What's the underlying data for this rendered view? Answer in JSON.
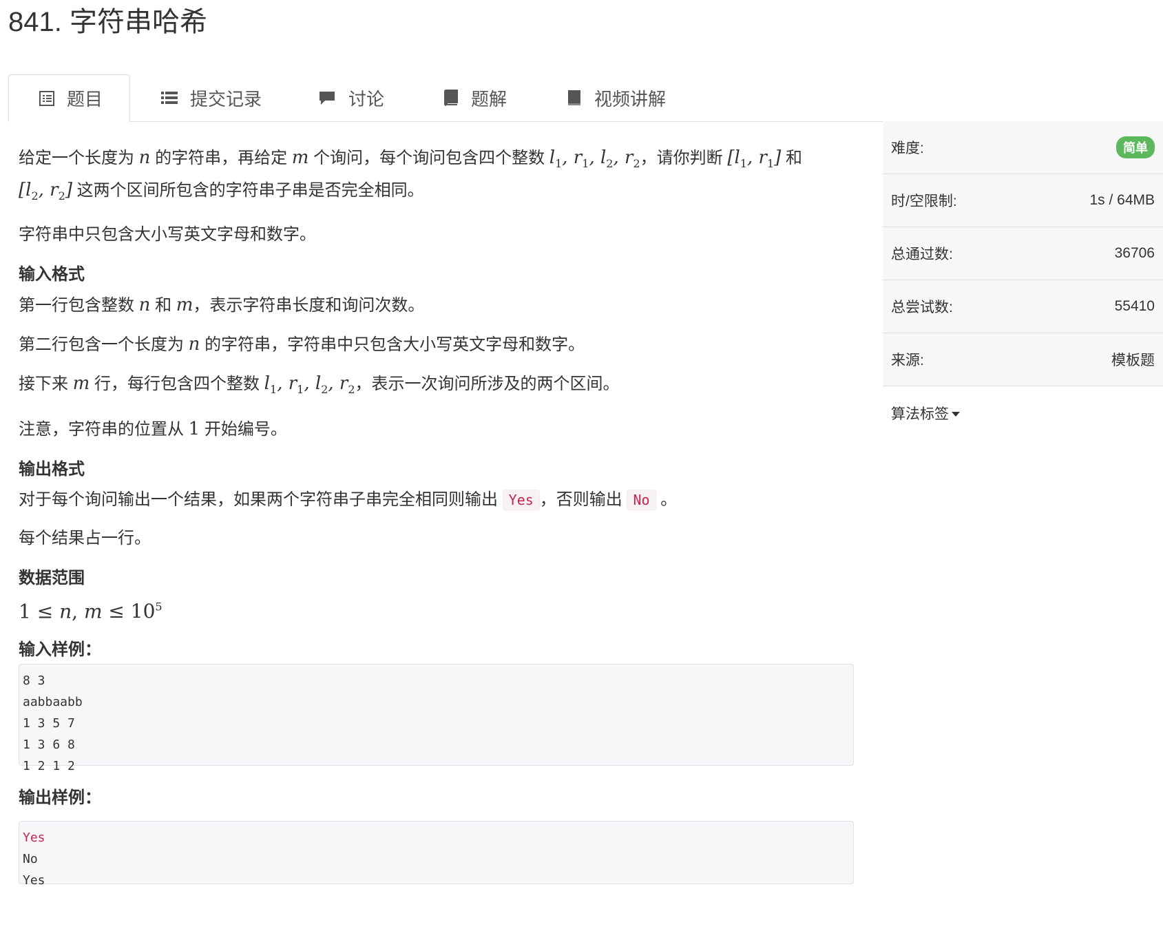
{
  "title": "841. 字符串哈希",
  "tabs": [
    {
      "label": "题目",
      "icon": "list-alt-icon"
    },
    {
      "label": "提交记录",
      "icon": "list-icon"
    },
    {
      "label": "讨论",
      "icon": "comment-icon"
    },
    {
      "label": "题解",
      "icon": "book-icon"
    },
    {
      "label": "视频讲解",
      "icon": "book-icon"
    }
  ],
  "problem": {
    "p1a": "给定一个长度为",
    "p1b": "的字符串，再给定",
    "p1c": "个询问，每个询问包含四个整数",
    "p1d": "，请你判断",
    "p1e": "和",
    "p1f": "这两个区间所包含的字符串子串是否完全相同。",
    "p2": "字符串中只包含大小写英文字母和数字。",
    "input_heading": "输入格式",
    "in1a": "第一行包含整数",
    "in1b": "和",
    "in1c": "，表示字符串长度和询问次数。",
    "in2a": "第二行包含一个长度为",
    "in2b": "的字符串，字符串中只包含大小写英文字母和数字。",
    "in3a": "接下来",
    "in3b": "行，每行包含四个整数",
    "in3c": "，表示一次询问所涉及的两个区间。",
    "in4a": "注意，字符串的位置从",
    "in4b": "开始编号。",
    "output_heading": "输出格式",
    "out1a": "对于每个询问输出一个结果，如果两个字符串子串完全相同则输出",
    "out1_yes": "Yes",
    "out1b": "，否则输出",
    "out1_no": "No",
    "out1c": "。",
    "out2": "每个结果占一行。",
    "range_heading": "数据范围",
    "sample_in_heading": "输入样例：",
    "sample_in": "8 3\naabbaabb\n1 3 5 7\n1 3 6 8\n1 2 1 2",
    "sample_out_heading": "输出样例：",
    "sample_out_first": "Yes",
    "sample_out_rest": "No\nYes"
  },
  "sidebar": {
    "difficulty_label": "难度:",
    "difficulty_value": "简单",
    "limit_label": "时/空限制:",
    "limit_value": "1s / 64MB",
    "passed_label": "总通过数:",
    "passed_value": "36706",
    "tried_label": "总尝试数:",
    "tried_value": "55410",
    "source_label": "来源:",
    "source_value": "模板题",
    "tags_label": "算法标签"
  },
  "colors": {
    "easy_badge": "#5cb85c",
    "code_red": "#c7254e"
  }
}
